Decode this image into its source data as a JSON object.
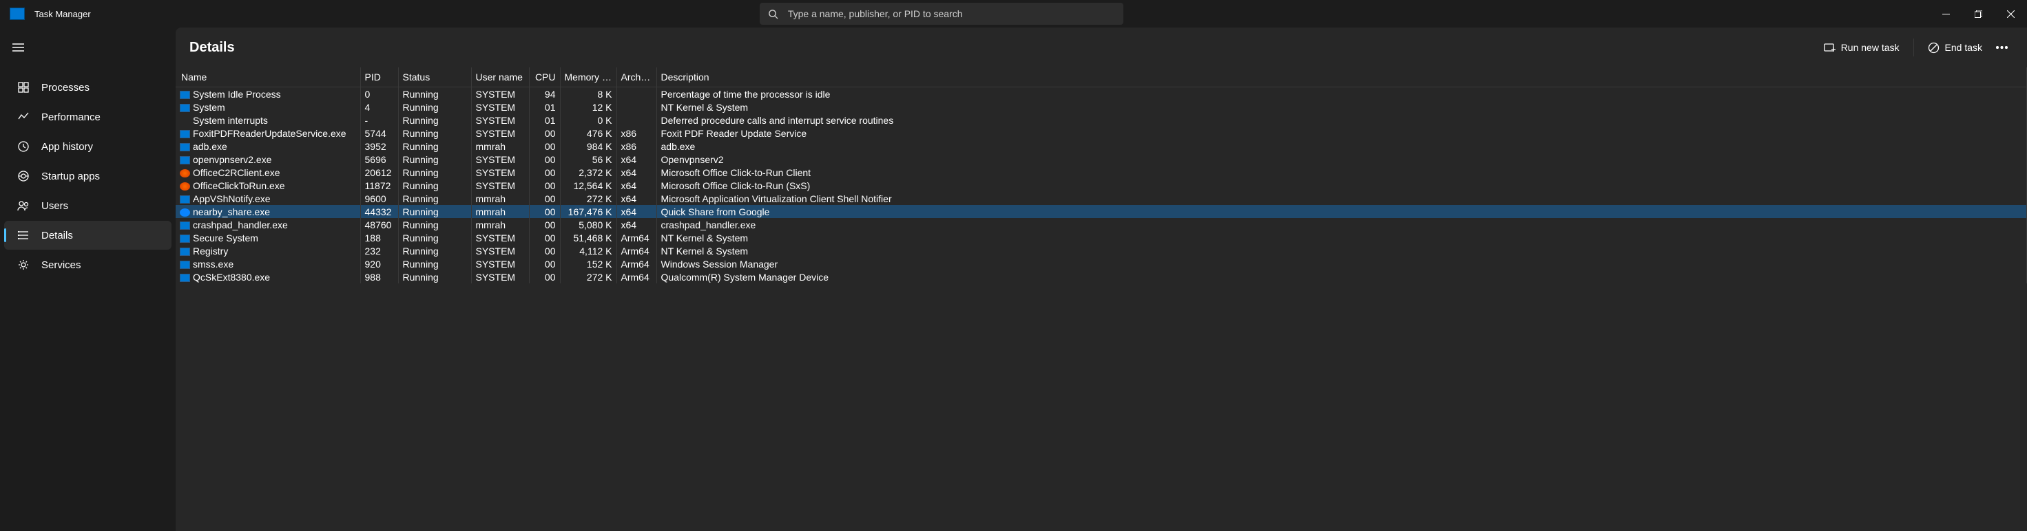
{
  "app": {
    "title": "Task Manager"
  },
  "search": {
    "placeholder": "Type a name, publisher, or PID to search"
  },
  "sidebar": {
    "items": [
      {
        "id": "processes",
        "label": "Processes"
      },
      {
        "id": "performance",
        "label": "Performance"
      },
      {
        "id": "app-history",
        "label": "App history"
      },
      {
        "id": "startup-apps",
        "label": "Startup apps"
      },
      {
        "id": "users",
        "label": "Users"
      },
      {
        "id": "details",
        "label": "Details"
      },
      {
        "id": "services",
        "label": "Services"
      }
    ],
    "active": "details"
  },
  "content": {
    "title": "Details",
    "actions": {
      "run_new_task": "Run new task",
      "end_task": "End task"
    }
  },
  "table": {
    "columns": {
      "name": "Name",
      "pid": "PID",
      "status": "Status",
      "user": "User name",
      "cpu": "CPU",
      "memory": "Memory (ac...",
      "arch": "Architec...",
      "desc": "Description"
    },
    "rows": [
      {
        "icon": "blue",
        "name": "System Idle Process",
        "pid": "0",
        "status": "Running",
        "user": "SYSTEM",
        "cpu": "94",
        "mem": "8 K",
        "arch": "",
        "desc": "Percentage of time the processor is idle"
      },
      {
        "icon": "blue",
        "name": "System",
        "pid": "4",
        "status": "Running",
        "user": "SYSTEM",
        "cpu": "01",
        "mem": "12 K",
        "arch": "",
        "desc": "NT Kernel & System"
      },
      {
        "icon": "none",
        "name": "System interrupts",
        "pid": "-",
        "status": "Running",
        "user": "SYSTEM",
        "cpu": "01",
        "mem": "0 K",
        "arch": "",
        "desc": "Deferred procedure calls and interrupt service routines"
      },
      {
        "icon": "blue",
        "name": "FoxitPDFReaderUpdateService.exe",
        "pid": "5744",
        "status": "Running",
        "user": "SYSTEM",
        "cpu": "00",
        "mem": "476 K",
        "arch": "x86",
        "desc": "Foxit PDF Reader Update Service"
      },
      {
        "icon": "blue",
        "name": "adb.exe",
        "pid": "3952",
        "status": "Running",
        "user": "mmrah",
        "cpu": "00",
        "mem": "984 K",
        "arch": "x86",
        "desc": "adb.exe"
      },
      {
        "icon": "blue",
        "name": "openvpnserv2.exe",
        "pid": "5696",
        "status": "Running",
        "user": "SYSTEM",
        "cpu": "00",
        "mem": "56 K",
        "arch": "x64",
        "desc": "Openvpnserv2"
      },
      {
        "icon": "orange",
        "name": "OfficeC2RClient.exe",
        "pid": "20612",
        "status": "Running",
        "user": "SYSTEM",
        "cpu": "00",
        "mem": "2,372 K",
        "arch": "x64",
        "desc": "Microsoft Office Click-to-Run Client"
      },
      {
        "icon": "orange",
        "name": "OfficeClickToRun.exe",
        "pid": "11872",
        "status": "Running",
        "user": "SYSTEM",
        "cpu": "00",
        "mem": "12,564 K",
        "arch": "x64",
        "desc": "Microsoft Office Click-to-Run (SxS)"
      },
      {
        "icon": "blue",
        "name": "AppVShNotify.exe",
        "pid": "9600",
        "status": "Running",
        "user": "mmrah",
        "cpu": "00",
        "mem": "272 K",
        "arch": "x64",
        "desc": "Microsoft Application Virtualization Client Shell Notifier"
      },
      {
        "icon": "share",
        "name": "nearby_share.exe",
        "pid": "44332",
        "status": "Running",
        "user": "mmrah",
        "cpu": "00",
        "mem": "167,476 K",
        "arch": "x64",
        "desc": "Quick Share from Google",
        "selected": true
      },
      {
        "icon": "blue",
        "name": "crashpad_handler.exe",
        "pid": "48760",
        "status": "Running",
        "user": "mmrah",
        "cpu": "00",
        "mem": "5,080 K",
        "arch": "x64",
        "desc": "crashpad_handler.exe"
      },
      {
        "icon": "blue",
        "name": "Secure System",
        "pid": "188",
        "status": "Running",
        "user": "SYSTEM",
        "cpu": "00",
        "mem": "51,468 K",
        "arch": "Arm64",
        "desc": "NT Kernel & System"
      },
      {
        "icon": "blue",
        "name": "Registry",
        "pid": "232",
        "status": "Running",
        "user": "SYSTEM",
        "cpu": "00",
        "mem": "4,112 K",
        "arch": "Arm64",
        "desc": "NT Kernel & System"
      },
      {
        "icon": "blue",
        "name": "smss.exe",
        "pid": "920",
        "status": "Running",
        "user": "SYSTEM",
        "cpu": "00",
        "mem": "152 K",
        "arch": "Arm64",
        "desc": "Windows Session Manager"
      },
      {
        "icon": "blue",
        "name": "QcSkExt8380.exe",
        "pid": "988",
        "status": "Running",
        "user": "SYSTEM",
        "cpu": "00",
        "mem": "272 K",
        "arch": "Arm64",
        "desc": "Qualcomm(R) System Manager Device"
      }
    ]
  }
}
